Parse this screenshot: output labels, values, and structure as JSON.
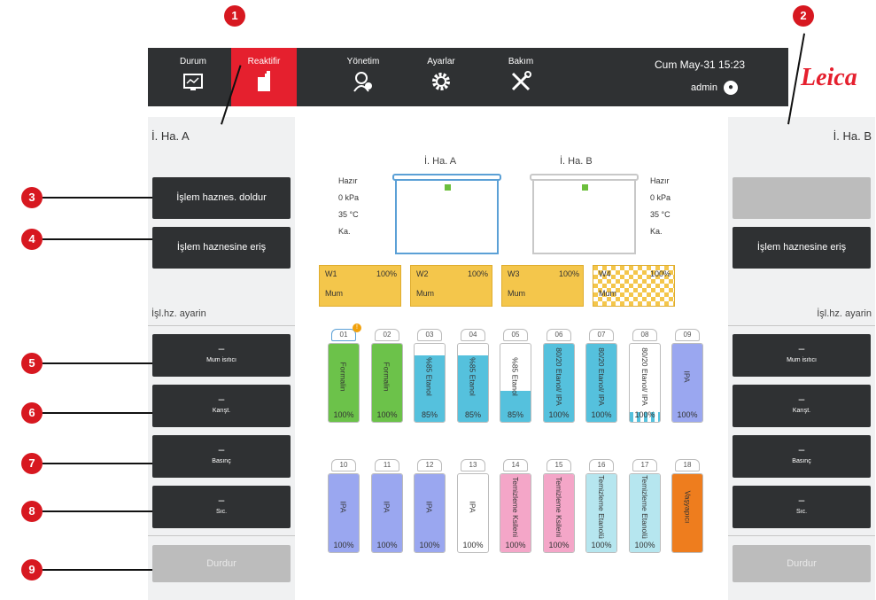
{
  "header": {
    "tabs": [
      {
        "label": "Durum",
        "icon": "status-icon"
      },
      {
        "label": "Reaktifir",
        "icon": "reagent-icon"
      },
      {
        "label": "Yönetim",
        "icon": "admin-icon"
      },
      {
        "label": "Ayarlar",
        "icon": "gear-icon"
      },
      {
        "label": "Bakım",
        "icon": "tools-icon"
      }
    ],
    "datetime": "Cum May-31 15:23",
    "user": "admin",
    "logo": "Leica",
    "active_color": "#e5202e"
  },
  "left_panel": {
    "title": "İ. Ha. A",
    "fill_button": "İşlem haznes. doldur",
    "access_button": "İşlem haznesine eriş",
    "settings_label": "İşl.hz. ayarin",
    "settings": [
      {
        "value": "–",
        "label": "Mum isıtıcı"
      },
      {
        "value": "–",
        "label": "Karışt."
      },
      {
        "value": "–",
        "label": "Basınç"
      },
      {
        "value": "–",
        "label": "Sıc."
      }
    ],
    "stop_button": "Durdur"
  },
  "right_panel": {
    "title": "İ. Ha. B",
    "fill_button": "",
    "access_button": "İşlem haznesine eriş",
    "settings_label": "İşl.hz. ayarin",
    "settings": [
      {
        "value": "–",
        "label": "Mum isıtıcı"
      },
      {
        "value": "–",
        "label": "Karışt."
      },
      {
        "value": "–",
        "label": "Basınç"
      },
      {
        "value": "–",
        "label": "Sıc."
      }
    ],
    "stop_button": "Durdur"
  },
  "retorts": {
    "a": {
      "label": "İ. Ha. A",
      "state": "Hazır",
      "pressure": "0 kPa",
      "temp": "35 °C",
      "lid": "Ka."
    },
    "b": {
      "label": "İ. Ha. B",
      "state": "Hazır",
      "pressure": "0 kPa",
      "temp": "35 °C",
      "lid": "Ka."
    }
  },
  "wax_baths": [
    {
      "id": "W1",
      "percent": "100%",
      "name": "Mum"
    },
    {
      "id": "W2",
      "percent": "100%",
      "name": "Mum"
    },
    {
      "id": "W3",
      "percent": "100%",
      "name": "Mum"
    },
    {
      "id": "W4",
      "percent": "100%",
      "name": "Mum"
    }
  ],
  "bottles_row1": [
    {
      "num": "01",
      "name": "Formalin",
      "percent": "100%",
      "color": "#6cc24a",
      "level": 1.0,
      "warning": true
    },
    {
      "num": "02",
      "name": "Formalin",
      "percent": "100%",
      "color": "#6cc24a",
      "level": 1.0
    },
    {
      "num": "03",
      "name": "%85 Etanol",
      "percent": "85%",
      "color": "#55c1dd",
      "level": 0.85
    },
    {
      "num": "04",
      "name": "%85 Etanol",
      "percent": "85%",
      "color": "#55c1dd",
      "level": 0.85
    },
    {
      "num": "05",
      "name": "%85 Etanol",
      "percent": "85%",
      "color": "#55c1dd",
      "level": 0.4
    },
    {
      "num": "06",
      "name": "80/20 Etanol/ IPA",
      "percent": "100%",
      "color": "#55c1dd",
      "level": 1.0
    },
    {
      "num": "07",
      "name": "80/20 Etanol/ IPA",
      "percent": "100%",
      "color": "#55c1dd",
      "level": 1.0
    },
    {
      "num": "08",
      "name": "80/20 Etanol/ IPA",
      "percent": "100%",
      "color": "#55c1dd",
      "level": 0.12,
      "striped": true
    },
    {
      "num": "09",
      "name": "IPA",
      "percent": "100%",
      "color": "#9aa7f0",
      "level": 1.0
    }
  ],
  "bottles_row2": [
    {
      "num": "10",
      "name": "IPA",
      "percent": "100%",
      "color": "#9aa7f0",
      "level": 1.0
    },
    {
      "num": "11",
      "name": "IPA",
      "percent": "100%",
      "color": "#9aa7f0",
      "level": 1.0
    },
    {
      "num": "12",
      "name": "IPA",
      "percent": "100%",
      "color": "#9aa7f0",
      "level": 1.0
    },
    {
      "num": "13",
      "name": "IPA",
      "percent": "100%",
      "color": "#ffffff",
      "level": 0.0
    },
    {
      "num": "14",
      "name": "Temizleme Ksileni",
      "percent": "100%",
      "color": "#f4a6c8",
      "level": 1.0
    },
    {
      "num": "15",
      "name": "Temizleme Ksileni",
      "percent": "100%",
      "color": "#f4a6c8",
      "level": 1.0
    },
    {
      "num": "16",
      "name": "Temizleme Etanolü",
      "percent": "100%",
      "color": "#b6e6ef",
      "level": 1.0
    },
    {
      "num": "17",
      "name": "Temizleme Etanolü",
      "percent": "100%",
      "color": "#b6e6ef",
      "level": 1.0
    },
    {
      "num": "18",
      "name": "Vaşyapıcı",
      "percent": "",
      "color": "#ee7d1e",
      "level": 1.0
    }
  ],
  "callouts": [
    "1",
    "2",
    "3",
    "4",
    "5",
    "6",
    "7",
    "8",
    "9"
  ]
}
